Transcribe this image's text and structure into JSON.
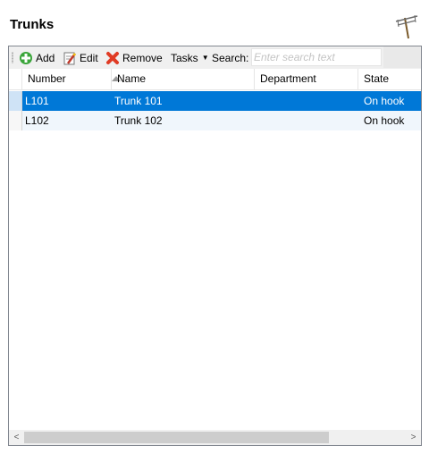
{
  "header": {
    "title": "Trunks",
    "icon": "antenna-icon"
  },
  "toolbar": {
    "add_label": "Add",
    "edit_label": "Edit",
    "remove_label": "Remove",
    "tasks_label": "Tasks",
    "search_label": "Search:",
    "search_placeholder": "Enter search text",
    "search_value": ""
  },
  "grid": {
    "columns": [
      "Number",
      "Name",
      "Department",
      "State"
    ],
    "sort_column": "Number",
    "rows": [
      {
        "number": "L101",
        "name": "Trunk 101",
        "department": "",
        "state": "On hook",
        "selected": true
      },
      {
        "number": "L102",
        "name": "Trunk 102",
        "department": "",
        "state": "On hook",
        "selected": false
      }
    ]
  },
  "colors": {
    "selection": "#0078d7",
    "alt_row": "#f0f6fc",
    "toolbar_bg": "#f0f0f0"
  }
}
